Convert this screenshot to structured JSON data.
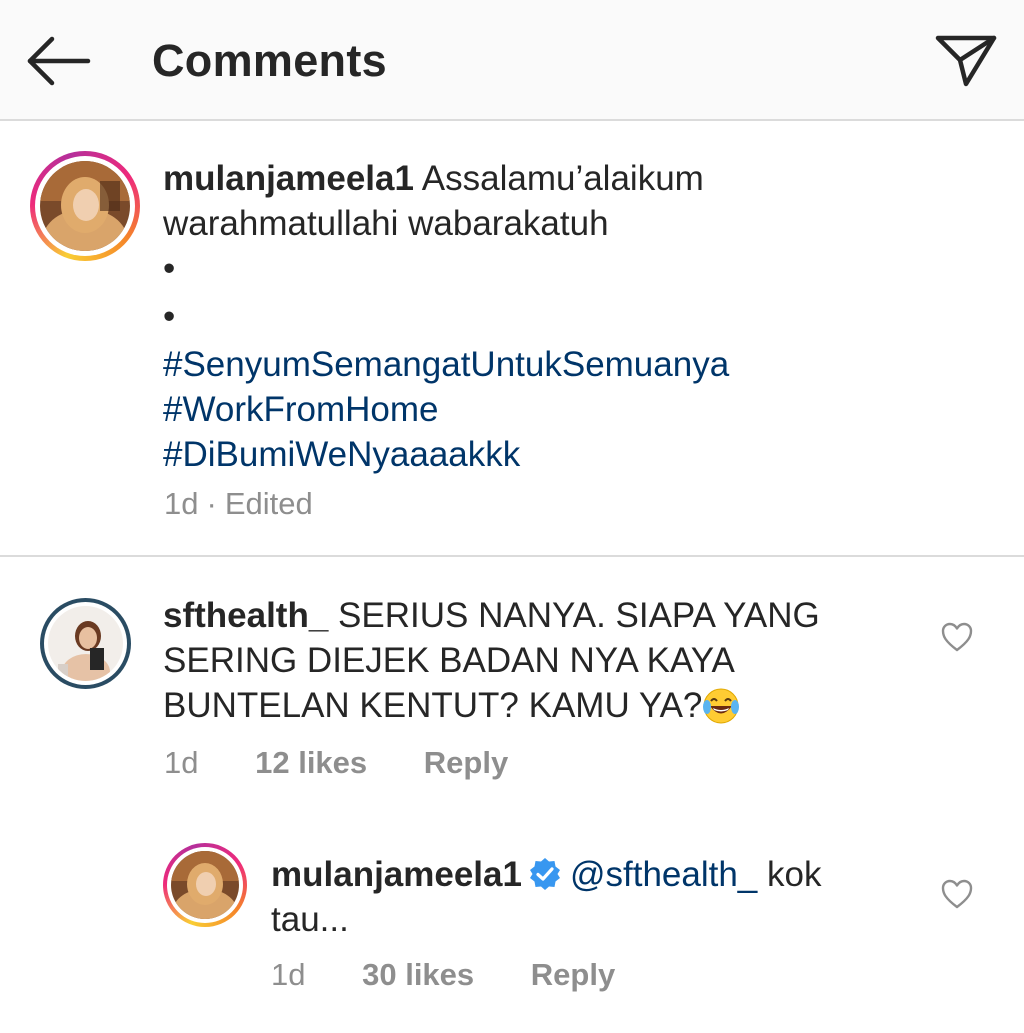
{
  "header": {
    "title": "Comments",
    "back_icon": "arrow-left-icon",
    "send_icon": "paper-plane-icon"
  },
  "caption": {
    "username": "mulanjameela1",
    "text_line1": "Assalamu’alaikum",
    "text_line2": "warahmatullahi wabarakatuh",
    "dot1": "•",
    "dot2": "•",
    "hashtags": [
      "#SenyumSemangatUntukSemuanya",
      "#WorkFromHome",
      "#DiBumiWeNyaaaakkk"
    ],
    "time": "1d",
    "separator": "·",
    "edited": "Edited"
  },
  "comments": [
    {
      "username": "sfthealth_",
      "text": "SERIUS NANYA. SIAPA YANG SERING DIEJEK BADAN NYA KAYA BUNTELAN KENTUT? KAMU YA?",
      "emoji": "😂",
      "time": "1d",
      "likes": "12 likes",
      "reply": "Reply"
    },
    {
      "username": "mulanjameela1",
      "verified": true,
      "mention": "@sfthealth_",
      "text": "kok tau...",
      "time": "1d",
      "likes": "30 likes",
      "reply": "Reply"
    }
  ],
  "colors": {
    "hashtag": "#003569",
    "meta": "#8e8e8e",
    "verified": "#3897f0",
    "divider": "#dbdbdb"
  }
}
